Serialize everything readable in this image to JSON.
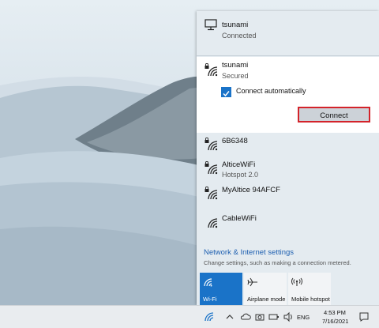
{
  "networks": {
    "current": {
      "name": "tsunami",
      "status": "Connected",
      "icon": "monitor-network-icon"
    },
    "selected": {
      "name": "tsunami",
      "status": "Secured",
      "icon": "wifi-secured-icon",
      "auto_connect_label": "Connect automatically",
      "auto_connect_checked": true,
      "connect_label": "Connect"
    },
    "others": [
      {
        "name": "6B6348",
        "sub": "",
        "secured": true
      },
      {
        "name": "AlticeWiFi",
        "sub": "Hotspot 2.0",
        "secured": true
      },
      {
        "name": "MyAltice 94AFCF",
        "sub": "",
        "secured": true
      },
      {
        "name": "CableWiFi",
        "sub": "",
        "secured": false
      }
    ]
  },
  "settings": {
    "title": "Network & Internet settings",
    "description": "Change settings, such as making a connection metered."
  },
  "quick_actions": [
    {
      "label": "Wi-Fi",
      "active": true,
      "icon": "wifi-icon"
    },
    {
      "label": "Airplane mode",
      "active": false,
      "icon": "airplane-icon"
    },
    {
      "label": "Mobile hotspot",
      "active": false,
      "icon": "hotspot-icon"
    }
  ],
  "taskbar": {
    "language": "ENG",
    "time": "4:53 PM",
    "date": "7/16/2021"
  },
  "colors": {
    "accent": "#1a73c8",
    "highlight_border": "#d3232a",
    "link": "#1d5fb0"
  }
}
